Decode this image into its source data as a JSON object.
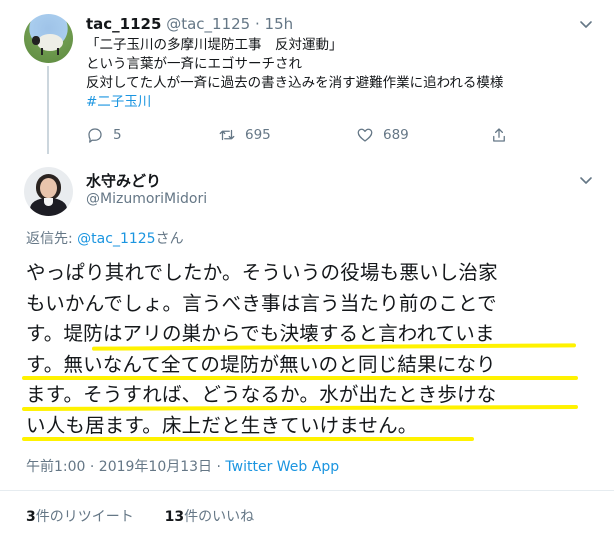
{
  "tweet1": {
    "name": "tac_1125",
    "handle": "@tac_1125",
    "separator": " · ",
    "time": "15h",
    "lines": [
      "「二子玉川の多摩川堤防工事　反対運動」",
      "という言葉が一斉にエゴサーチされ",
      "反対してた人が一斉に過去の書き込みを消す避難作業に追われる模様"
    ],
    "hashtag": "#二子玉川",
    "reply_count": "5",
    "retweet_count": "695",
    "like_count": "689"
  },
  "tweet2": {
    "name": "水守みどり",
    "handle": "@MizumoriMidori",
    "reply_prefix": "返信先: ",
    "reply_mention": "@tac_1125",
    "reply_suffix": "さん",
    "text_lines": [
      "やっぱり其れでしたか。そういうの役場も悪いし治家",
      "もいかんでしょ。言うべき事は言う当たり前のことで",
      "す。堤防はアリの巣からでも決壊すると言われていま",
      "す。無いなんて全ての堤防が無いのと同じ結果になり",
      "ます。そうすれば、どうなるか。水が出たとき歩けな",
      "い人も居ます。床上だと生きていけません。"
    ],
    "timestamp": "午前1:00 · 2019年10月13日 · ",
    "source": "Twitter Web App",
    "retweets_count": "3",
    "retweets_label": "件のリツイート",
    "likes_count": "13",
    "likes_label": "件のいいね"
  },
  "colors": {
    "link": "#1b95e0",
    "muted": "#657786",
    "highlight": "#fff200",
    "divider": "#e6ecf0"
  },
  "icons": [
    "reply-icon",
    "retweet-icon",
    "like-icon",
    "share-icon",
    "chevron-down-icon"
  ]
}
